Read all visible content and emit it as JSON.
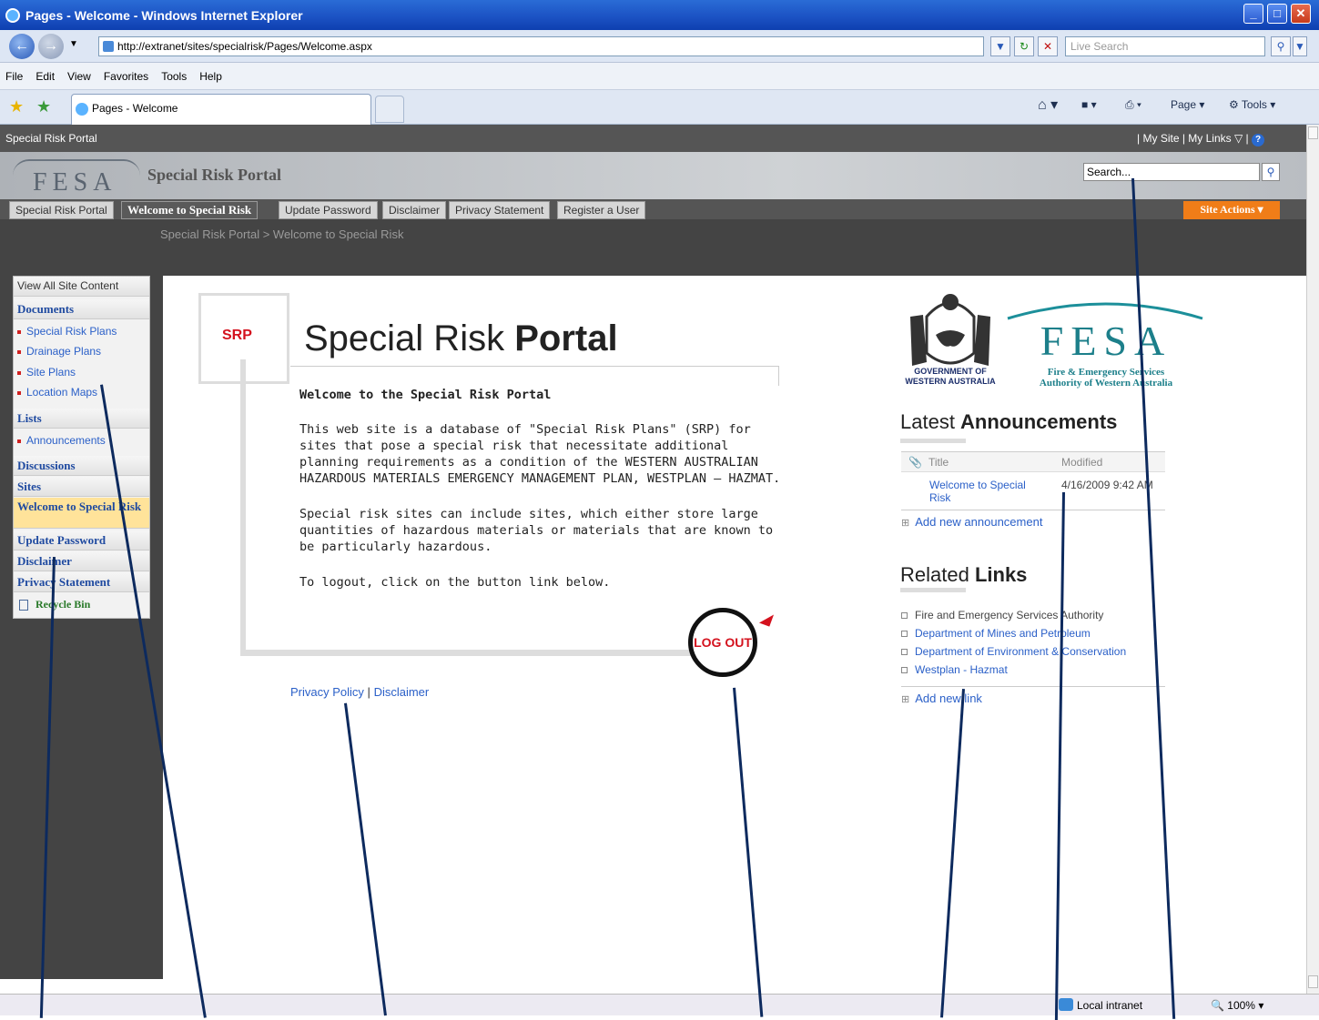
{
  "browser": {
    "window_title": "Pages - Welcome - Windows Internet Explorer",
    "url": "http://extranet/sites/specialrisk/Pages/Welcome.aspx",
    "live_search_placeholder": "Live Search",
    "menu": [
      "File",
      "Edit",
      "View",
      "Favorites",
      "Tools",
      "Help"
    ],
    "tab_label": "Pages - Welcome",
    "command_page": "Page",
    "command_tools": "Tools",
    "status_zone": "Local intranet",
    "zoom": "100%"
  },
  "site": {
    "top_label": "Special Risk Portal",
    "my_site": "My Site",
    "my_links": "My Links",
    "logo_text": "FESA",
    "title": "Special Risk Portal",
    "search_value": "Search...",
    "top_tabs": [
      "Special Risk Portal",
      "Welcome to Special Risk",
      "Update Password",
      "Disclaimer",
      "Privacy Statement",
      "Register a User"
    ],
    "site_actions": "Site Actions",
    "breadcrumb": "Special Risk Portal > Welcome to Special Risk"
  },
  "quicklaunch": {
    "view_all": "View All Site Content",
    "documents": "Documents",
    "doc_items": [
      "Special Risk Plans",
      "Drainage Plans",
      "Site Plans",
      "Location Maps"
    ],
    "lists": "Lists",
    "list_items": [
      "Announcements"
    ],
    "discussions": "Discussions",
    "sites": "Sites",
    "welcome": "Welcome to Special Risk",
    "update_password": "Update Password",
    "disclaimer": "Disclaimer",
    "privacy": "Privacy Statement",
    "recycle": "Recycle Bin"
  },
  "main": {
    "srp_badge": "SRP",
    "portal_title_light": "Special Risk ",
    "portal_title_bold": "Portal",
    "welcome_heading": "Welcome to the Special Risk Portal",
    "para1": "This web site is a database of \"Special Risk Plans\" (SRP) for sites that pose a special risk that necessitate additional planning requirements as a condition of the WESTERN AUSTRALIAN HAZARDOUS MATERIALS EMERGENCY MANAGEMENT PLAN, WESTPLAN – HAZMAT.",
    "para2": "Special risk sites can include sites, which either store large quantities of hazardous materials or materials that are known to be particularly hazardous.",
    "para3": "To logout, click on the button link below.",
    "logout": "LOG OUT",
    "privacy_policy": "Privacy Policy",
    "footer_sep": "|",
    "disclaimer": "Disclaimer"
  },
  "right": {
    "gov_line1": "GOVERNMENT OF",
    "gov_line2": "WESTERN AUSTRALIA",
    "fesa_big": "FESA",
    "fesa_line1": "Fire & Emergency Services",
    "fesa_line2": "Authority of Western Australia",
    "ann_light": "Latest ",
    "ann_bold": "Announcements",
    "col_title": "Title",
    "col_modified": "Modified",
    "ann_item_title": "Welcome to Special Risk",
    "ann_item_date": "4/16/2009 9:42 AM",
    "add_announcement": "Add new announcement",
    "links_light": "Related ",
    "links_bold": "Links",
    "links": [
      "Fire and Emergency Services Authority",
      "Department of Mines and Petroleum",
      "Department of Environment & Conservation",
      "Westplan - Hazmat"
    ],
    "add_link": "Add new link"
  }
}
